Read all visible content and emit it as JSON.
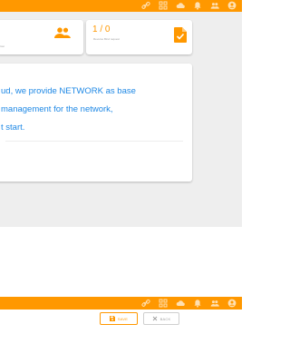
{
  "stats": [
    {
      "value": "",
      "caption": "rcer",
      "icon": "people-icon"
    },
    {
      "value": "1 / 0",
      "caption": "Reverse Bind request",
      "icon": "document-icon"
    }
  ],
  "info": {
    "lines": [
      "ud, we provide NETWORK as base",
      "management for the network,",
      "t start."
    ]
  },
  "actions": {
    "save_label": "SAVE",
    "back_label": "BACK"
  },
  "colors": {
    "accent": "#ff9800",
    "info_text": "#1e88e5",
    "background": "#eeeeee"
  }
}
